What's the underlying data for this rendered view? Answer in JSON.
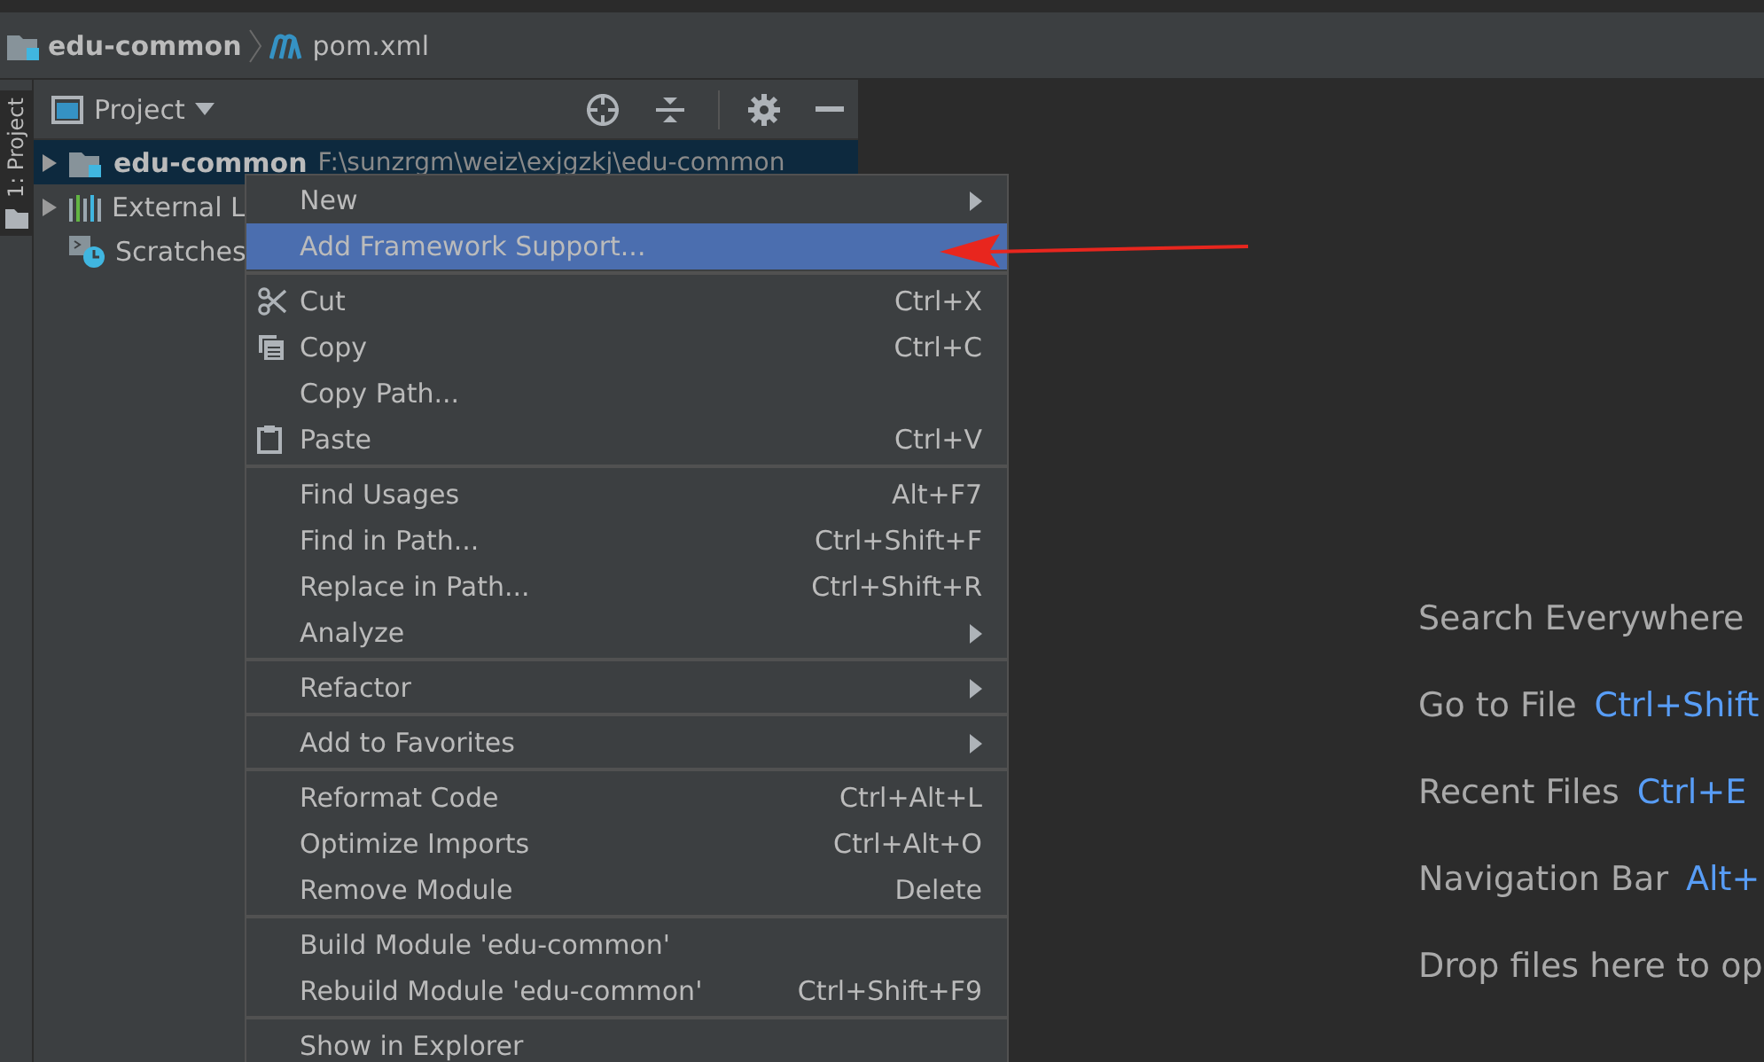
{
  "breadcrumb": [
    {
      "label": "edu-common"
    },
    {
      "label": "pom.xml"
    }
  ],
  "tool_strip": {
    "tab": "1: Project",
    "selected": true
  },
  "project_panel": {
    "title": "Project",
    "tree": [
      {
        "label": "edu-common",
        "path": "F:\\sunzrgm\\weiz\\exjgzkj\\edu-common",
        "selected": true,
        "expanded": false
      },
      {
        "label": "External L",
        "selected": false,
        "expanded": false
      },
      {
        "label": "Scratches",
        "selected": false
      }
    ]
  },
  "context_menu": [
    {
      "kind": "item",
      "label": "New",
      "submenu": true,
      "selected": false
    },
    {
      "kind": "item",
      "label": "Add Framework Support...",
      "selected": true
    },
    {
      "kind": "separator"
    },
    {
      "kind": "item",
      "label": "Cut",
      "shortcut": "Ctrl+X",
      "selected": false
    },
    {
      "kind": "item",
      "label": "Copy",
      "shortcut": "Ctrl+C",
      "selected": false
    },
    {
      "kind": "item",
      "label": "Copy Path...",
      "selected": false
    },
    {
      "kind": "item",
      "label": "Paste",
      "shortcut": "Ctrl+V",
      "selected": false
    },
    {
      "kind": "separator"
    },
    {
      "kind": "item",
      "label": "Find Usages",
      "shortcut": "Alt+F7",
      "selected": false
    },
    {
      "kind": "item",
      "label": "Find in Path...",
      "shortcut": "Ctrl+Shift+F",
      "selected": false
    },
    {
      "kind": "item",
      "label": "Replace in Path...",
      "shortcut": "Ctrl+Shift+R",
      "selected": false
    },
    {
      "kind": "item",
      "label": "Analyze",
      "submenu": true,
      "selected": false
    },
    {
      "kind": "separator"
    },
    {
      "kind": "item",
      "label": "Refactor",
      "submenu": true,
      "selected": false
    },
    {
      "kind": "separator"
    },
    {
      "kind": "item",
      "label": "Add to Favorites",
      "submenu": true,
      "selected": false
    },
    {
      "kind": "separator"
    },
    {
      "kind": "item",
      "label": "Reformat Code",
      "shortcut": "Ctrl+Alt+L",
      "selected": false
    },
    {
      "kind": "item",
      "label": "Optimize Imports",
      "shortcut": "Ctrl+Alt+O",
      "selected": false
    },
    {
      "kind": "item",
      "label": "Remove Module",
      "shortcut": "Delete",
      "selected": false
    },
    {
      "kind": "separator"
    },
    {
      "kind": "item",
      "label": "Build Module 'edu-common'",
      "selected": false
    },
    {
      "kind": "item",
      "label": "Rebuild Module 'edu-common'",
      "shortcut": "Ctrl+Shift+F9",
      "selected": false
    },
    {
      "kind": "separator"
    },
    {
      "kind": "item",
      "label": "Show in Explorer",
      "selected": false
    }
  ],
  "editor_hints": [
    {
      "label": "Search Everywhere"
    },
    {
      "label": "Go to File",
      "shortcut": "Ctrl+Shift"
    },
    {
      "label": "Recent Files",
      "shortcut": "Ctrl+E"
    },
    {
      "label": "Navigation Bar",
      "shortcut": "Alt+"
    },
    {
      "label": "Drop files here to op"
    }
  ]
}
